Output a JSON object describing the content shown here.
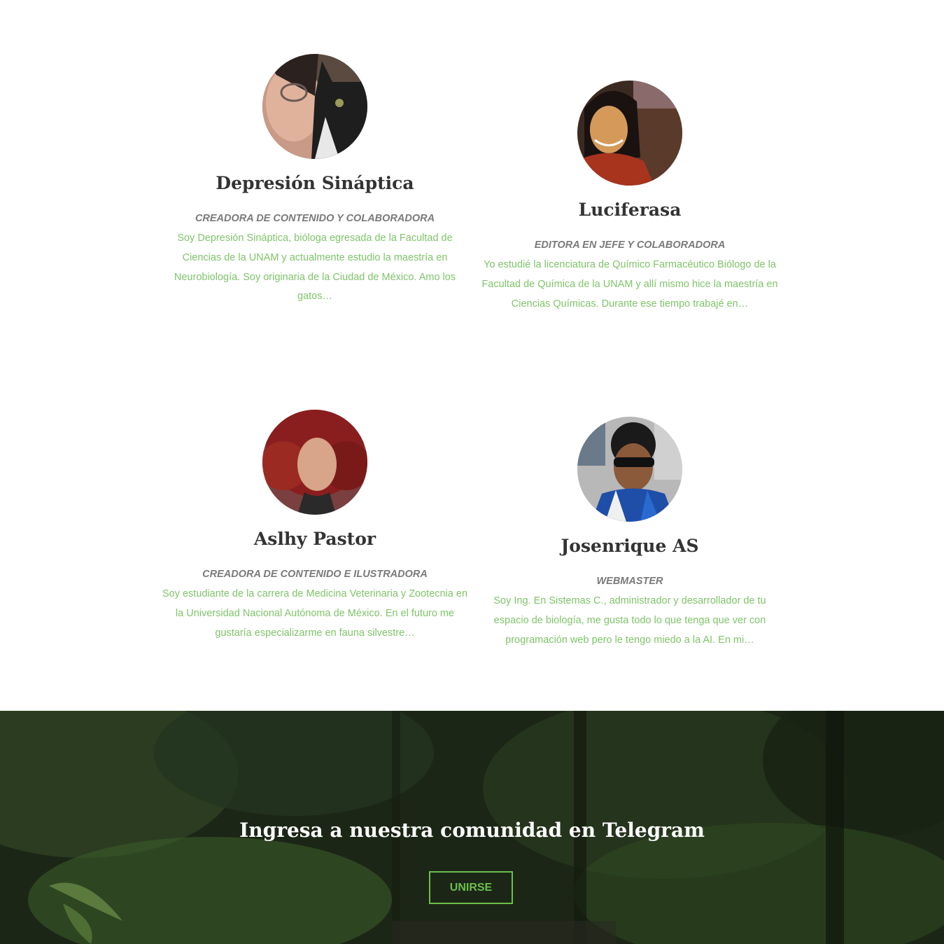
{
  "team": [
    {
      "name": "Depresión Sináptica",
      "role": "CREADORA DE CONTENIDO Y COLABORADORA",
      "bio": "Soy Depresión Sináptica, bióloga egresada de la Facultad de Ciencias de la UNAM y actualmente estudio la maestría en Neurobiología. Soy originaria de la Ciudad de México. Amo los gatos…"
    },
    {
      "name": "Luciferasa",
      "role": "EDITORA EN JEFE Y COLABORADORA",
      "bio": "Yo estudié la licenciatura de Químico Farmacéutico Biólogo de la Facultad de Química de la UNAM y allí mismo hice la maestría en Ciencias Químicas. Durante ese tiempo trabajé en…"
    },
    {
      "name": "Aslhy Pastor",
      "role": "CREADORA DE CONTENIDO E ILUSTRADORA",
      "bio": "Soy estudiante de la carrera de Medicina Veterinaria y Zootecnia en la Universidad Nacional Autónoma de México. En el futuro me gustaría especializarme en fauna silvestre…"
    },
    {
      "name": "Josenrique AS",
      "role": "WEBMASTER",
      "bio": "Soy Ing. En Sistemas C., administrador y desarrollador de tu espacio de biología, me gusta todo lo que tenga que ver con programación web pero le tengo miedo a la AI. En mi…"
    }
  ],
  "cta": {
    "title": "Ingresa a nuestra comunidad en Telegram",
    "button_label": "UNIRSE"
  },
  "colors": {
    "accent_green": "#6abf4b",
    "bio_green": "#7fc46a",
    "name_dark": "#333333",
    "role_gray": "#7a7a7a"
  }
}
